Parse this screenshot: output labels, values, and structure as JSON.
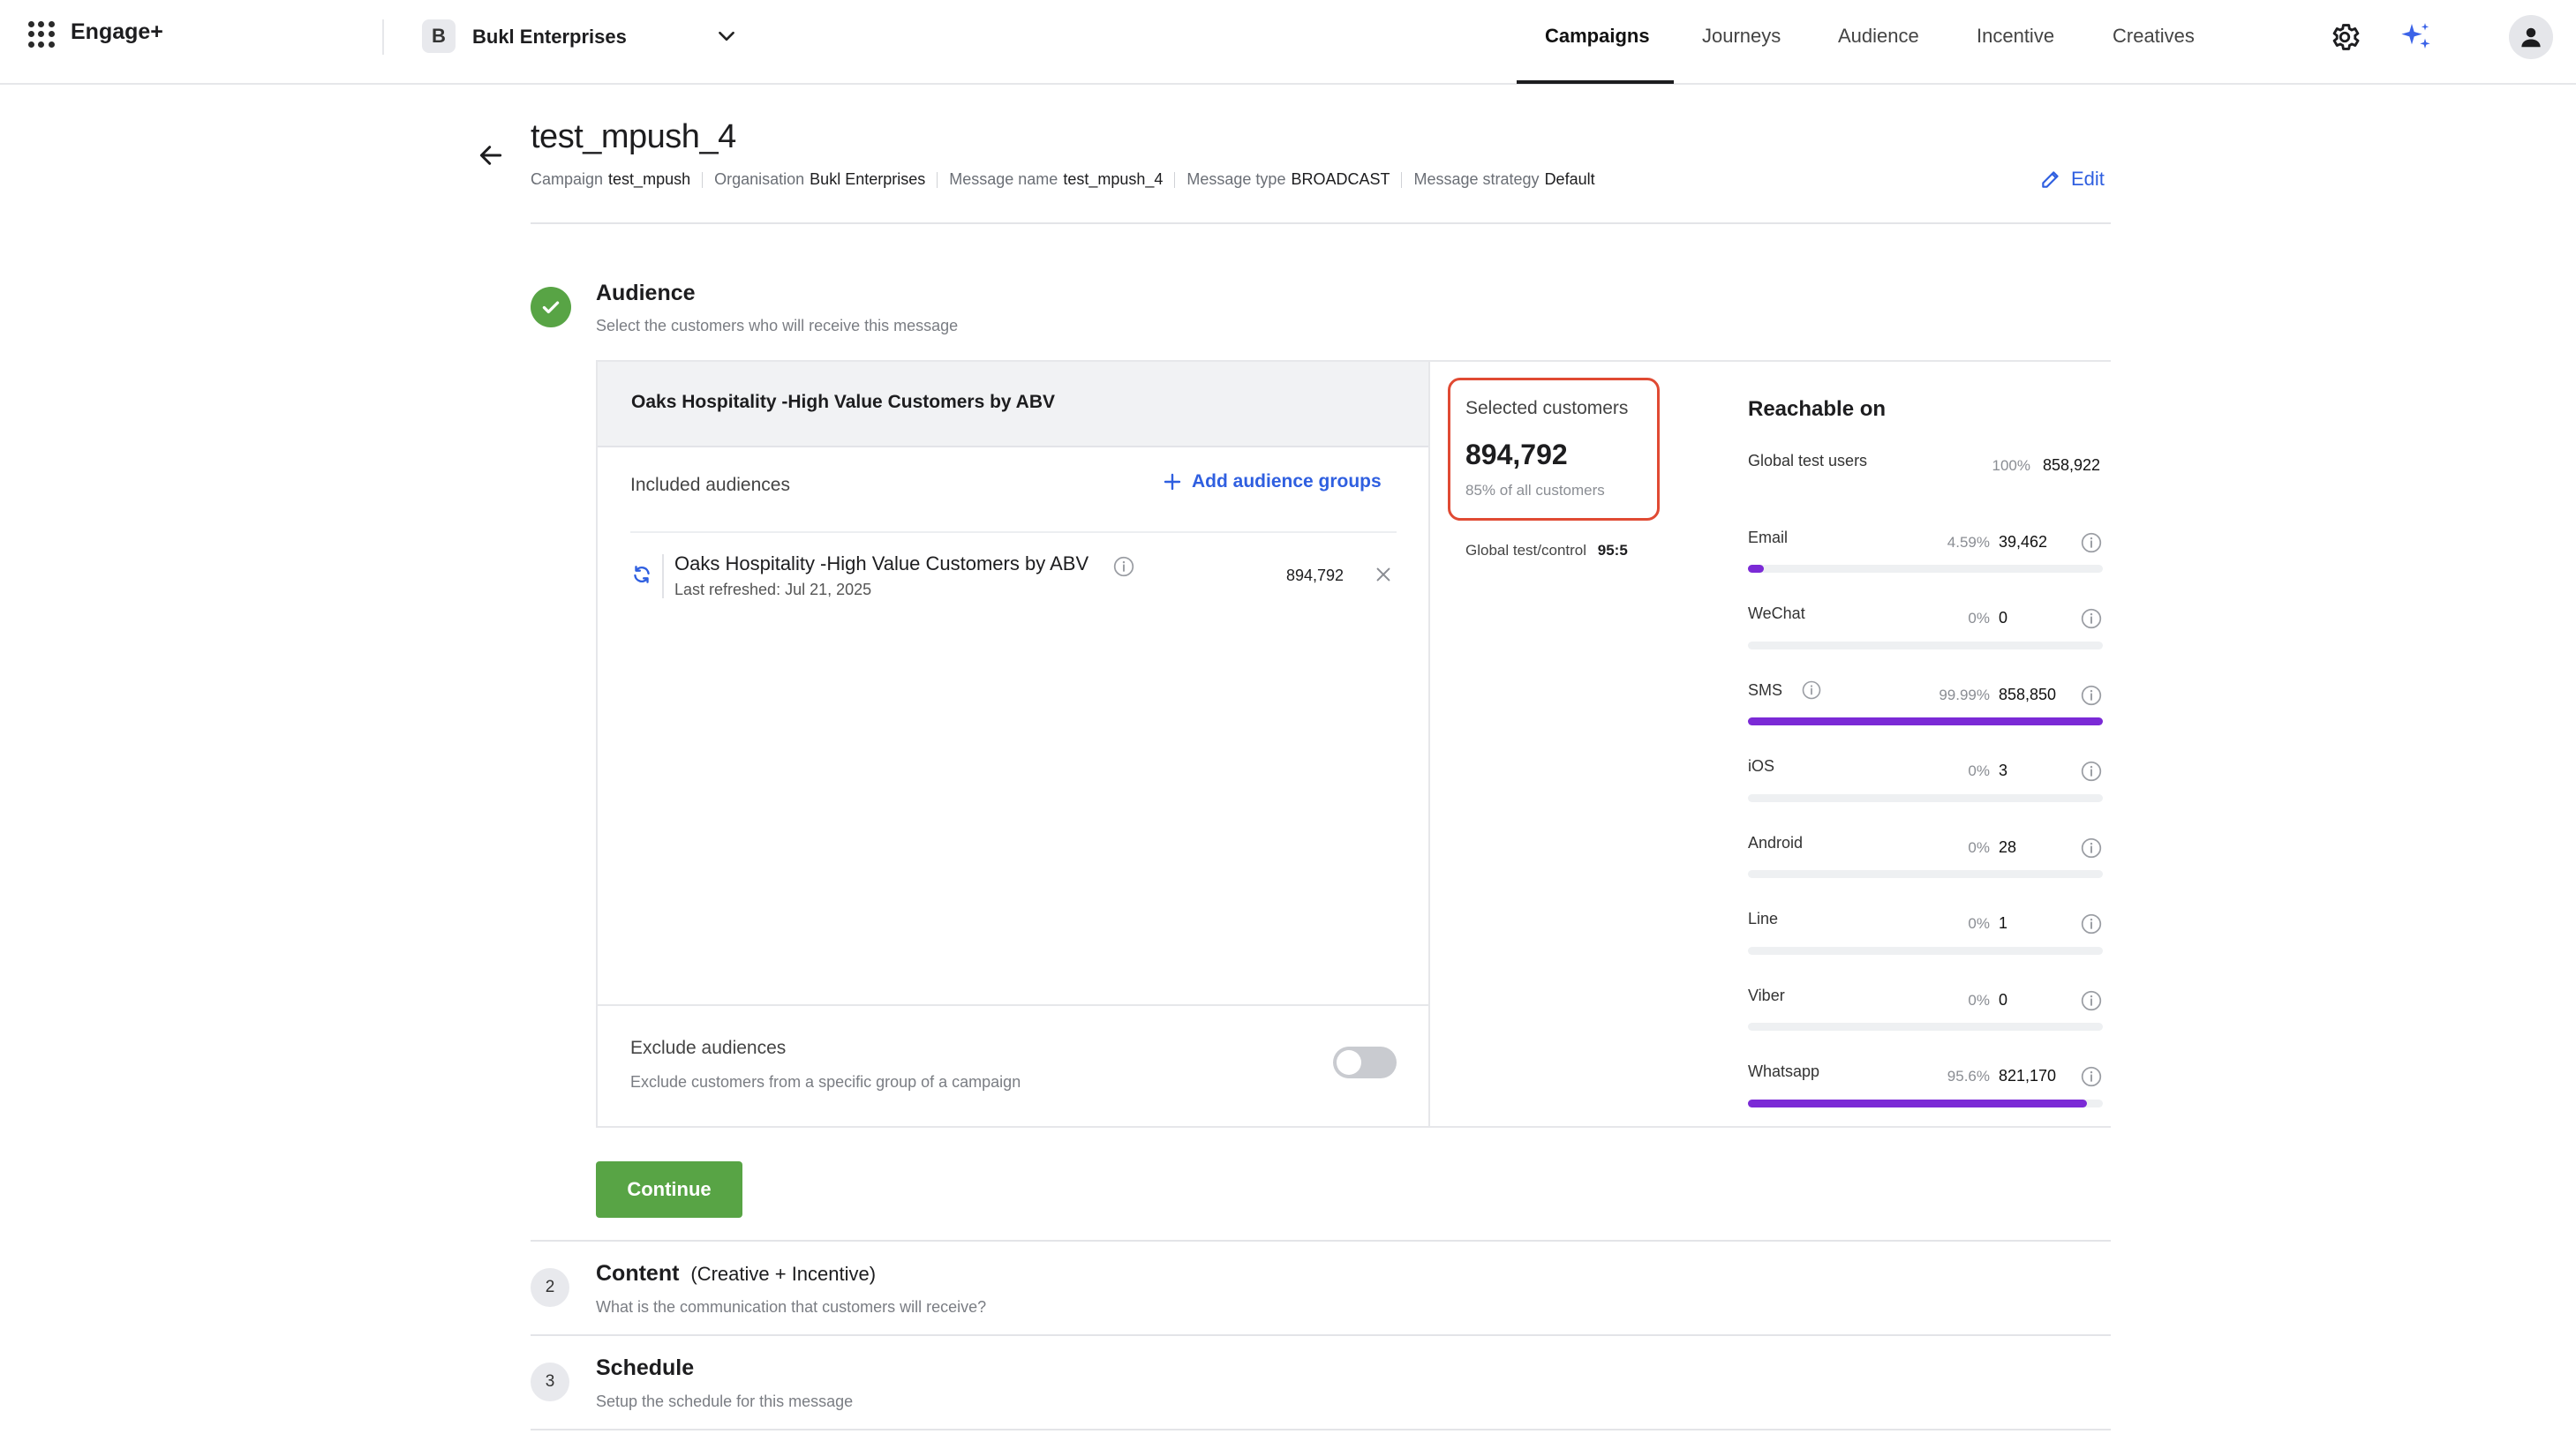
{
  "topbar": {
    "brand": "Engage+",
    "org_initial": "B",
    "org_name": "Bukl Enterprises",
    "tabs": [
      "Campaigns",
      "Journeys",
      "Audience",
      "Incentive",
      "Creatives"
    ],
    "active_tab": "Campaigns"
  },
  "header": {
    "title": "test_mpush_4",
    "meta": [
      {
        "label": "Campaign",
        "value": "test_mpush"
      },
      {
        "label": "Organisation",
        "value": "Bukl Enterprises"
      },
      {
        "label": "Message name",
        "value": "test_mpush_4"
      },
      {
        "label": "Message type",
        "value": "BROADCAST"
      },
      {
        "label": "Message strategy",
        "value": "Default"
      }
    ],
    "edit_label": "Edit"
  },
  "audience_step": {
    "title": "Audience",
    "subtitle": "Select the customers who will receive this message",
    "group_name": "Oaks Hospitality -High Value Customers by ABV",
    "included_label": "Included audiences",
    "add_groups_label": "Add audience groups",
    "row": {
      "name": "Oaks Hospitality -High Value Customers by ABV",
      "refreshed": "Last refreshed: Jul 21, 2025",
      "count": "894,792"
    },
    "exclude_title": "Exclude audiences",
    "exclude_sub": "Exclude customers from a specific group of a campaign",
    "exclude_enabled": false,
    "selected_label": "Selected customers",
    "selected_count": "894,792",
    "selected_pct": "85% of all customers",
    "global_tc_label": "Global test/control",
    "global_tc_value": "95:5",
    "reachable_title": "Reachable on",
    "channels": [
      {
        "name": "Global test users",
        "pct": "100%",
        "count": "858,922",
        "fill": null,
        "info": false,
        "name_info": false
      },
      {
        "name": "Email",
        "pct": "4.59%",
        "count": "39,462",
        "fill": 0.0459,
        "info": true,
        "name_info": false
      },
      {
        "name": "WeChat",
        "pct": "0%",
        "count": "0",
        "fill": 0,
        "info": true,
        "name_info": false
      },
      {
        "name": "SMS",
        "pct": "99.99%",
        "count": "858,850",
        "fill": 0.9999,
        "info": true,
        "name_info": true
      },
      {
        "name": "iOS",
        "pct": "0%",
        "count": "3",
        "fill": 0,
        "info": true,
        "name_info": false
      },
      {
        "name": "Android",
        "pct": "0%",
        "count": "28",
        "fill": 0,
        "info": true,
        "name_info": false
      },
      {
        "name": "Line",
        "pct": "0%",
        "count": "1",
        "fill": 0,
        "info": true,
        "name_info": false
      },
      {
        "name": "Viber",
        "pct": "0%",
        "count": "0",
        "fill": 0,
        "info": true,
        "name_info": false
      },
      {
        "name": "Whatsapp",
        "pct": "95.6%",
        "count": "821,170",
        "fill": 0.956,
        "info": true,
        "name_info": false
      }
    ],
    "continue_label": "Continue"
  },
  "content_step": {
    "number": "2",
    "title": "Content",
    "title_suffix": "(Creative + Incentive)",
    "subtitle": "What is the communication that customers will receive?"
  },
  "schedule_step": {
    "number": "3",
    "title": "Schedule",
    "subtitle": "Setup the schedule for this message"
  },
  "colors": {
    "accent_blue": "#2f5fe0",
    "success_green": "#58a445",
    "bar_purple": "#7b2ad6",
    "highlight_red": "#e04a33"
  }
}
